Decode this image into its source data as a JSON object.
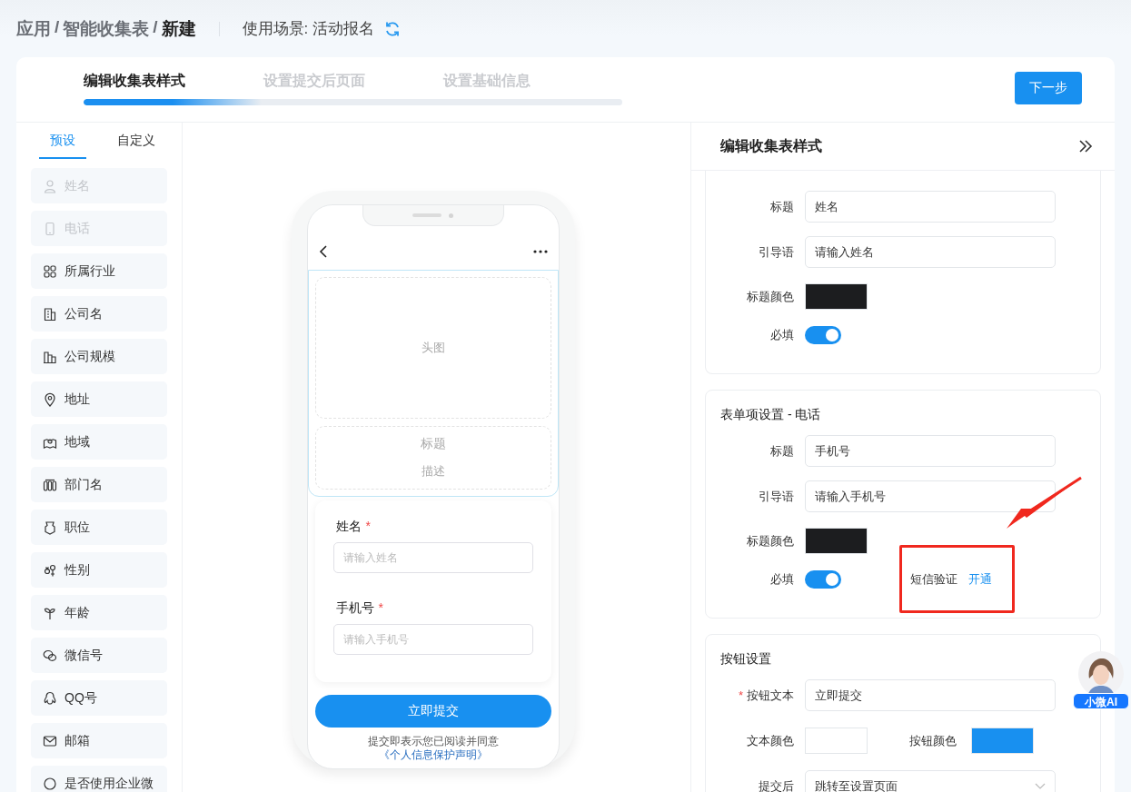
{
  "breadcrumb": [
    {
      "label": "应用",
      "current": false
    },
    {
      "label": "智能收集表",
      "current": false
    },
    {
      "label": "新建",
      "current": true
    }
  ],
  "breadcrumb_separators": [
    "/",
    "/"
  ],
  "scene": "使用场景: 活动报名",
  "steps": [
    {
      "label": "编辑收集表样式",
      "selected": true
    },
    {
      "label": "设置提交后页面",
      "selected": false
    },
    {
      "label": "设置基础信息",
      "selected": false
    }
  ],
  "progress": {
    "level": 0.33
  },
  "next_button": "下一步",
  "sidebar": {
    "tabs": [
      {
        "label": "预设",
        "selected": true
      },
      {
        "label": "自定义",
        "selected": false
      }
    ],
    "items": [
      {
        "label": "姓名",
        "disabled": true
      },
      {
        "label": "电话",
        "disabled": true
      },
      {
        "label": "所属行业",
        "disabled": false
      },
      {
        "label": "公司名",
        "disabled": false
      },
      {
        "label": "公司规模",
        "disabled": false
      },
      {
        "label": "地址",
        "disabled": false
      },
      {
        "label": "地域",
        "disabled": false
      },
      {
        "label": "部门名",
        "disabled": false
      },
      {
        "label": "职位",
        "disabled": false
      },
      {
        "label": "性别",
        "disabled": false
      },
      {
        "label": "年龄",
        "disabled": false
      },
      {
        "label": "微信号",
        "disabled": false
      },
      {
        "label": "QQ号",
        "disabled": false
      },
      {
        "label": "邮箱",
        "disabled": false
      },
      {
        "label": "是否使用企业微",
        "disabled": false
      }
    ]
  },
  "phone": {
    "banner": "头图",
    "title": "标题",
    "description": "描述",
    "fields": [
      {
        "label": "姓名",
        "required_mark": "*",
        "placeholder": "请输入姓名"
      },
      {
        "label": "手机号",
        "required_mark": "*",
        "placeholder": "请输入手机号"
      }
    ],
    "submit": "立即提交",
    "agreement": "提交即表示您已阅读并同意",
    "agreement_link": "《个人信息保护声明》"
  },
  "panel": {
    "title": "编辑收集表样式",
    "sections": [
      {
        "fields": [
          {
            "kind": "input",
            "label": "标题",
            "value": "姓名"
          },
          {
            "kind": "input",
            "label": "引导语",
            "value": "请输入姓名"
          },
          {
            "kind": "color",
            "label": "标题颜色",
            "color": "#1c1d1f"
          },
          {
            "kind": "toggle",
            "label": "必填",
            "on": true
          }
        ]
      },
      {
        "title": "表单项设置 - 电话",
        "fields": [
          {
            "kind": "input",
            "label": "标题",
            "value": "手机号"
          },
          {
            "kind": "input",
            "label": "引导语",
            "value": "请输入手机号"
          },
          {
            "kind": "color",
            "label": "标题颜色",
            "color": "#1c1d1f"
          },
          {
            "kind": "toggle",
            "label": "必填",
            "on": true,
            "extra_label": "短信验证",
            "extra_link": "开通"
          }
        ]
      },
      {
        "title": "按钮设置",
        "fields": [
          {
            "kind": "input",
            "label": "按钮文本",
            "value": "立即提交",
            "required_mark": "*"
          },
          {
            "kind": "colors",
            "swatches": [
              {
                "label": "文本颜色",
                "color": "#ffffff"
              },
              {
                "label": "按钮颜色",
                "color": "#1890f0"
              }
            ]
          },
          {
            "kind": "select",
            "label": "提交后",
            "value": "跳转至设置页面"
          }
        ]
      }
    ]
  },
  "assistant": {
    "label": "小微AI"
  }
}
